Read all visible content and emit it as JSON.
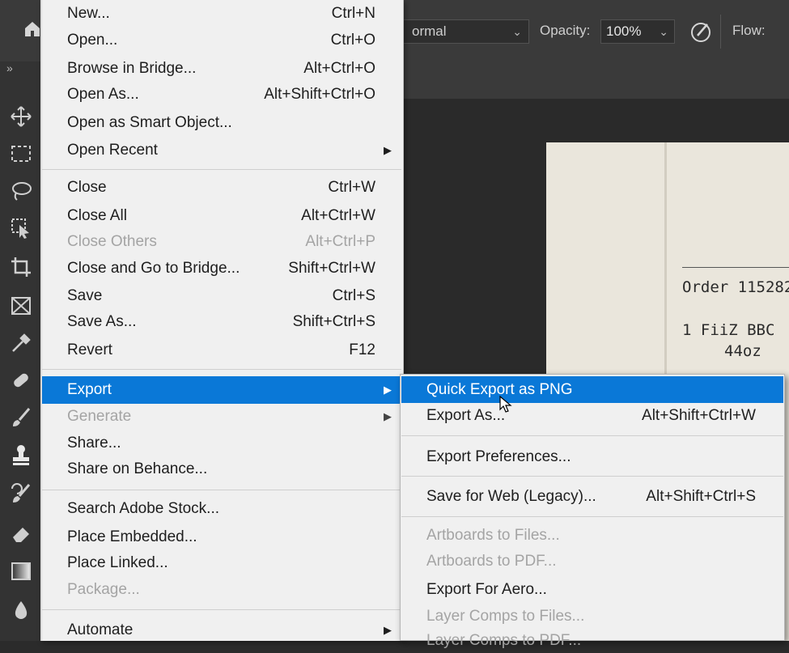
{
  "options_bar": {
    "blend_mode": "ormal",
    "opacity_label": "Opacity:",
    "opacity_value": "100%",
    "flow_label": "Flow:"
  },
  "toolbar": {
    "collapse": "»",
    "tools": [
      "move-tool-icon",
      "rectangular-marquee-icon",
      "lasso-icon",
      "object-selection-icon",
      "crop-icon",
      "frame-icon",
      "eyedropper-icon",
      "spot-healing-icon",
      "brush-icon",
      "clone-stamp-icon",
      "history-brush-icon",
      "eraser-icon",
      "gradient-icon",
      "blur-icon"
    ]
  },
  "file_menu": {
    "items": [
      {
        "label": "New...",
        "shortcut": "Ctrl+N"
      },
      {
        "label": "Open...",
        "shortcut": "Ctrl+O"
      },
      {
        "label": "Browse in Bridge...",
        "shortcut": "Alt+Ctrl+O"
      },
      {
        "label": "Open As...",
        "shortcut": "Alt+Shift+Ctrl+O"
      },
      {
        "label": "Open as Smart Object...",
        "shortcut": ""
      },
      {
        "label": "Open Recent",
        "shortcut": ""
      },
      {
        "label": "Close",
        "shortcut": "Ctrl+W"
      },
      {
        "label": "Close All",
        "shortcut": "Alt+Ctrl+W"
      },
      {
        "label": "Close Others",
        "shortcut": "Alt+Ctrl+P"
      },
      {
        "label": "Close and Go to Bridge...",
        "shortcut": "Shift+Ctrl+W"
      },
      {
        "label": "Save",
        "shortcut": "Ctrl+S"
      },
      {
        "label": "Save As...",
        "shortcut": "Shift+Ctrl+S"
      },
      {
        "label": "Revert",
        "shortcut": "F12"
      },
      {
        "label": "Export",
        "shortcut": ""
      },
      {
        "label": "Generate",
        "shortcut": ""
      },
      {
        "label": "Share...",
        "shortcut": ""
      },
      {
        "label": "Share on Behance...",
        "shortcut": ""
      },
      {
        "label": "Search Adobe Stock...",
        "shortcut": ""
      },
      {
        "label": "Place Embedded...",
        "shortcut": ""
      },
      {
        "label": "Place Linked...",
        "shortcut": ""
      },
      {
        "label": "Package...",
        "shortcut": ""
      },
      {
        "label": "Automate",
        "shortcut": ""
      }
    ]
  },
  "export_submenu": {
    "items": [
      {
        "label": "Quick Export as PNG",
        "shortcut": ""
      },
      {
        "label": "Export As...",
        "shortcut": "Alt+Shift+Ctrl+W"
      },
      {
        "label": "Export Preferences...",
        "shortcut": ""
      },
      {
        "label": "Save for Web (Legacy)...",
        "shortcut": "Alt+Shift+Ctrl+S"
      },
      {
        "label": "Artboards to Files...",
        "shortcut": ""
      },
      {
        "label": "Artboards to PDF...",
        "shortcut": ""
      },
      {
        "label": "Export For Aero...",
        "shortcut": ""
      },
      {
        "label": "Layer Comps to Files...",
        "shortcut": ""
      },
      {
        "label": "Layer Comps to PDF...",
        "shortcut": ""
      }
    ]
  },
  "receipt": {
    "order_line": "Order 115282",
    "item_line": "1 FiiZ BBC",
    "size_line": "44oz"
  },
  "colors": {
    "menu_highlight": "#0a78d7",
    "menu_bg": "#f0f0f0",
    "toolbar_bg": "#333333"
  }
}
